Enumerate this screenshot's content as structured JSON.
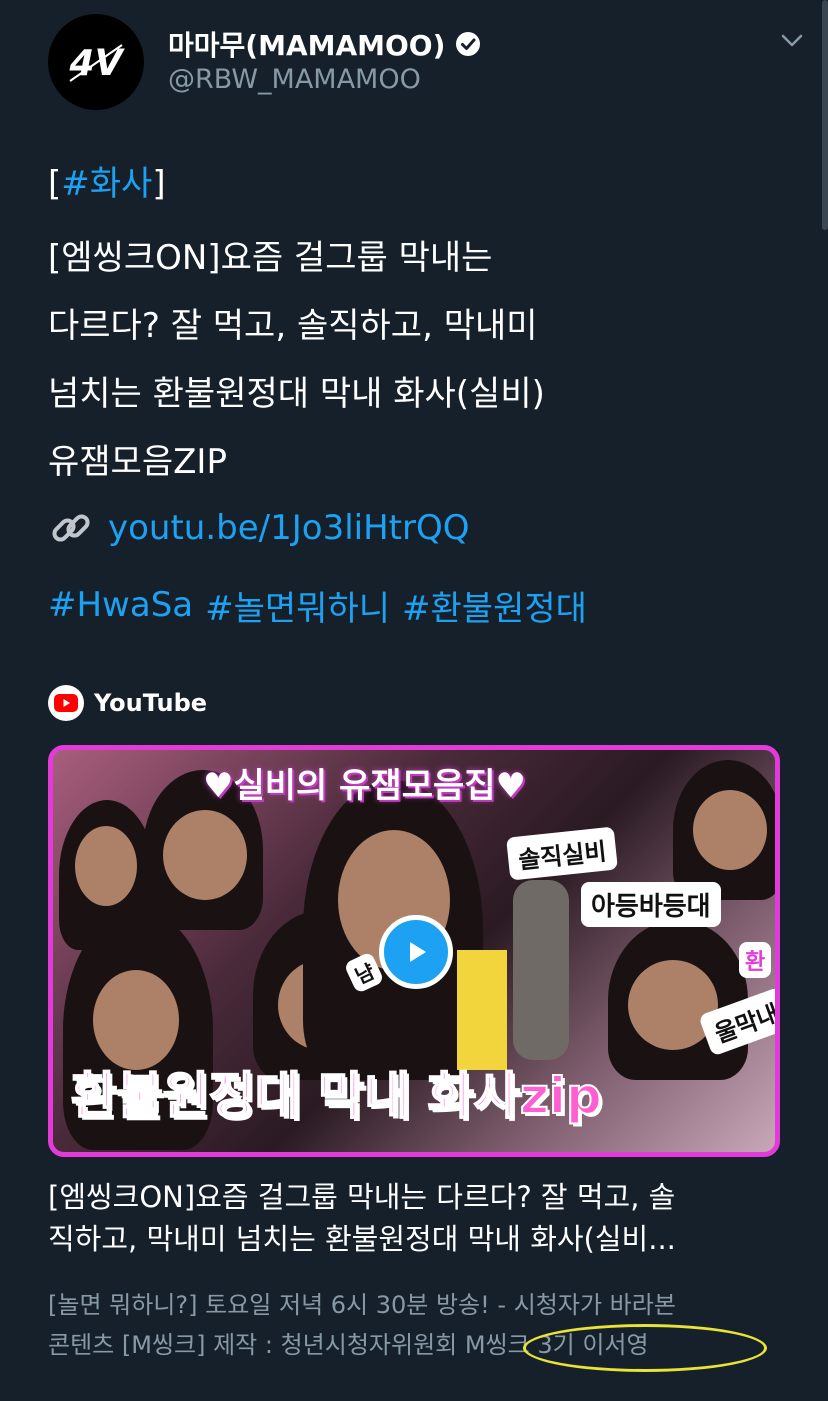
{
  "author": {
    "avatar_text": "4ᐯ",
    "display_name": "마마무(MAMAMOO)",
    "handle": "@RBW_MAMAMOO"
  },
  "tweet": {
    "hashtag_top": "[#화사]",
    "hashtag_top_open": "[",
    "hashtag_top_tag": "#화사",
    "hashtag_top_close": "]",
    "lines": [
      "[엠씽크ON]요즘 걸그룹 막내는",
      "다르다? 잘 먹고, 솔직하고, 막내미",
      "넘치는 환불원정대 막내 화사(실비)",
      "유잼모음ZIP"
    ],
    "link_text": "youtu.be/1Jo3liHtrQQ",
    "hashtags": [
      "#HwaSa",
      "#놀면뭐하니",
      "#환불원정대"
    ]
  },
  "card": {
    "source": "YouTube",
    "thumbnail": {
      "top_caption": "♥실비의 유잼모음집♥",
      "bottom_caption": "환불원정대 막내 화사zip",
      "stickers": [
        "솔직실비",
        "아등바등대",
        "울막내",
        "냠",
        "환"
      ]
    },
    "title_lines": [
      "[엠씽크ON]요즘 걸그룹 막내는 다르다? 잘 먹고, 솔",
      "직하고, 막내미 넘치는 환불원정대 막내 화사(실비..."
    ],
    "description_lines": [
      "[놀면 뭐하니?] 토요일 저녁 6시 30분 방송! - 시청자가 바라본",
      "콘텐츠 [M씽크] 제작 : 청년시청자위원회 M씽크 3기 이서영"
    ]
  },
  "colors": {
    "background": "#15202b",
    "link_blue": "#1da1f2",
    "secondary_text": "#8899a6",
    "thumbnail_border": "#e23bd9",
    "annotation_yellow": "#e8e334"
  }
}
